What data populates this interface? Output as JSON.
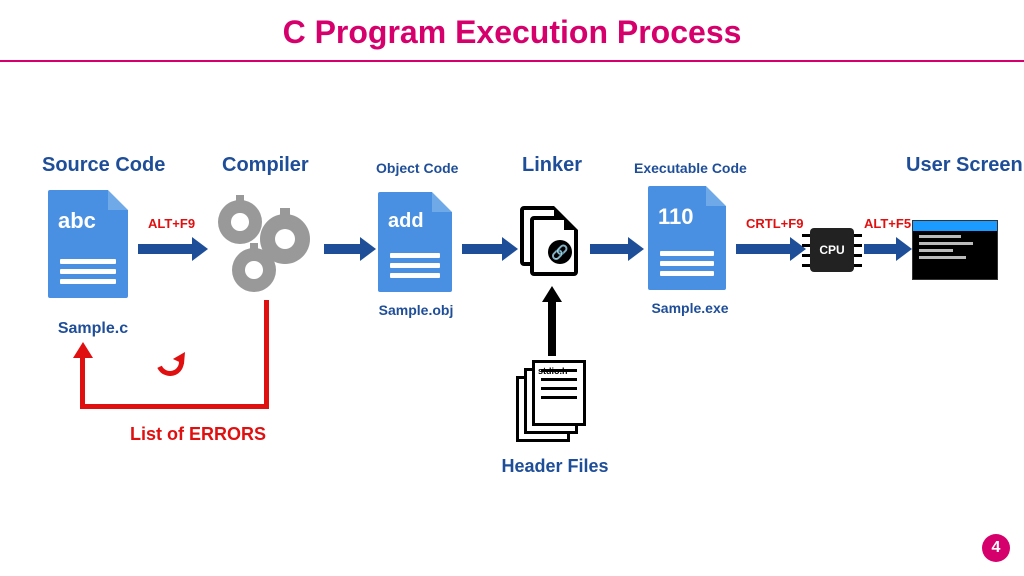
{
  "title": "C Program Execution Process",
  "stages": {
    "source": {
      "label": "Source Code",
      "doc_text": "abc",
      "caption": "Sample.c"
    },
    "compiler": {
      "label": "Compiler"
    },
    "object": {
      "label": "Object Code",
      "doc_text": "add",
      "caption": "Sample.obj"
    },
    "linker": {
      "label": "Linker"
    },
    "executable": {
      "label": "Executable Code",
      "doc_text": "110",
      "caption": "Sample.exe"
    },
    "cpu": {
      "label": "CPU"
    },
    "screen": {
      "label": "User Screen"
    }
  },
  "hotkeys": {
    "compile": "ALT+F9",
    "run": "CRTL+F9",
    "view": "ALT+F5"
  },
  "errors_label": "List of ERRORS",
  "header_files": {
    "label": "Header Files",
    "example": "stdio.h"
  },
  "page_number": "4"
}
